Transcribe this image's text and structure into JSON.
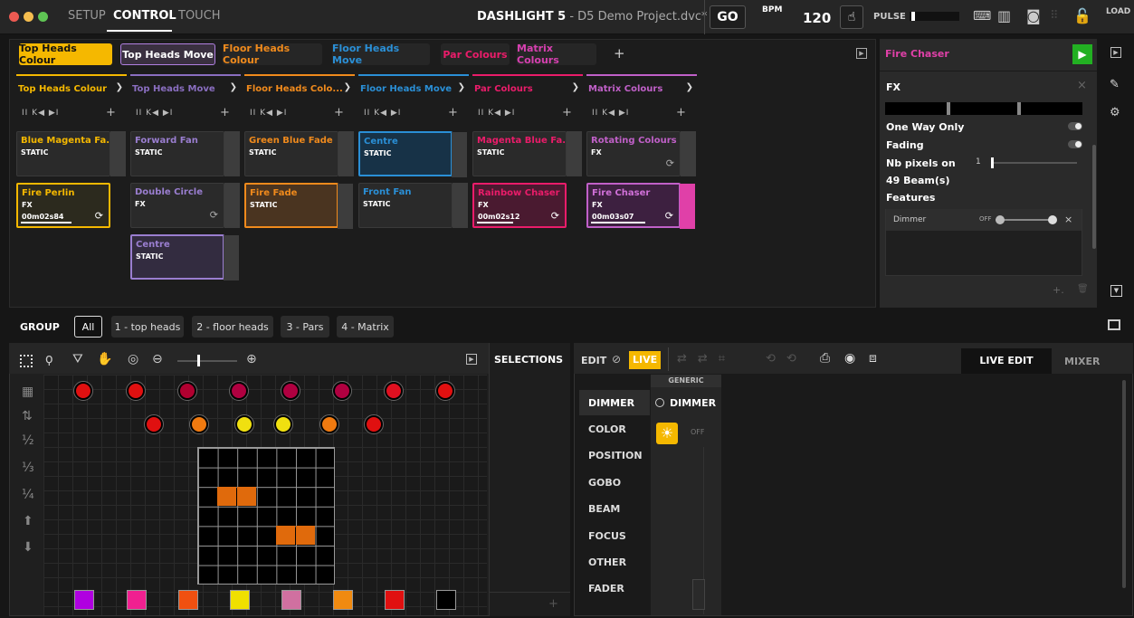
{
  "window": {
    "app": "DASHLIGHT 5",
    "project": " - D5 Demo Project.dvc*"
  },
  "topbar": {
    "modes": [
      "SETUP",
      "CONTROL",
      "TOUCH"
    ],
    "go_label": "GO",
    "bpm_label": "BPM",
    "bpm_value": "120",
    "pulse_label": "PULSE",
    "load_label": "LOAD"
  },
  "pages": [
    {
      "label": "Top Heads Colour",
      "color": "#f5b800"
    },
    {
      "label": "Top Heads Move",
      "color": "#b07fe0"
    },
    {
      "label": "Floor Heads Colour",
      "color": "#f08a1c"
    },
    {
      "label": "Floor Heads Move",
      "color": "#2a8fd6"
    },
    {
      "label": "Par Colours",
      "color": "#ea1c6a"
    },
    {
      "label": "Matrix Colours",
      "color": "#d640b0"
    }
  ],
  "add_label": "+",
  "columns": [
    {
      "title": "Top Heads Colour",
      "color": "#f5b800"
    },
    {
      "title": "Top Heads Move",
      "color": "#8a6ec0"
    },
    {
      "title": "Floor Heads Colo...",
      "color": "#f08a1c"
    },
    {
      "title": "Floor Heads Move",
      "color": "#2a8fd6"
    },
    {
      "title": "Par Colours",
      "color": "#ea1c6a"
    },
    {
      "title": "Matrix Colours",
      "color": "#c060c8"
    }
  ],
  "playback_controls": {
    "glyph": "II  K◀  ▶I",
    "plus": "+"
  },
  "cues": {
    "c1": {
      "name": "Blue Magenta Fa...",
      "type": "STATIC"
    },
    "c2": {
      "name": "Fire Perlin",
      "type": "FX",
      "time": "00m02s84"
    },
    "c3": {
      "name": "Forward Fan",
      "type": "STATIC"
    },
    "c4": {
      "name": "Double Circle",
      "type": "FX"
    },
    "c5": {
      "name": "Centre",
      "type": "STATIC"
    },
    "c6": {
      "name": "Green Blue Fade",
      "type": "STATIC"
    },
    "c7": {
      "name": "Fire Fade",
      "type": "STATIC"
    },
    "c8": {
      "name": "Centre",
      "type": "STATIC"
    },
    "c9": {
      "name": "Front Fan",
      "type": "STATIC"
    },
    "c10": {
      "name": "Magenta Blue Fa...",
      "type": "STATIC"
    },
    "c11": {
      "name": "Rainbow Chaser",
      "type": "FX",
      "time": "00m02s12"
    },
    "c12": {
      "name": "Rotating Colours",
      "type": "FX"
    },
    "c13": {
      "name": "Fire Chaser",
      "type": "FX",
      "time": "00m03s07"
    }
  },
  "loop_icon": "⟳",
  "right_panel": {
    "title": "Fire Chaser",
    "fx_label": "FX",
    "close": "×",
    "one_way": "One Way Only",
    "fading": "Fading",
    "nb_pixels": "Nb pixels on",
    "nb_value": "1",
    "beams": "49 Beam(s)",
    "features": "Features",
    "dimmer": "Dimmer",
    "off": "OFF",
    "remove": "×",
    "footer_add": "+.",
    "footer_trash": "🗑"
  },
  "group": {
    "label": "GROUP",
    "buttons": [
      "All",
      "1 - top heads",
      "2 - floor heads",
      "3 - Pars",
      "4 - Matrix"
    ]
  },
  "selections": {
    "label": "SELECTIONS",
    "add": "+"
  },
  "fractions": [
    "½",
    "⅓",
    "¼"
  ],
  "editor": {
    "edit": "EDIT",
    "live": "LIVE",
    "tabs": [
      "LIVE EDIT",
      "MIXER"
    ],
    "attributes": [
      "DIMMER",
      "COLOR",
      "POSITION",
      "GOBO",
      "BEAM",
      "FOCUS",
      "OTHER",
      "FADER"
    ],
    "generic": "GENERIC",
    "dimmer_param": "DIMMER",
    "off": "OFF"
  },
  "fixture_colors": {
    "row1": [
      "#e01010",
      "#e01010",
      "#b00030",
      "#b00040",
      "#b00040",
      "#b00040",
      "#e01020",
      "#e01010"
    ],
    "row2": [
      "#e01010",
      "#f07a10",
      "#f0e010",
      "#f0e010",
      "#f07a10",
      "#e01010"
    ],
    "bottom": [
      "#b000e0",
      "#f02090",
      "#f05010",
      "#f0e000",
      "#d070a0",
      "#f08a10",
      "#e01010",
      "#000000"
    ]
  }
}
